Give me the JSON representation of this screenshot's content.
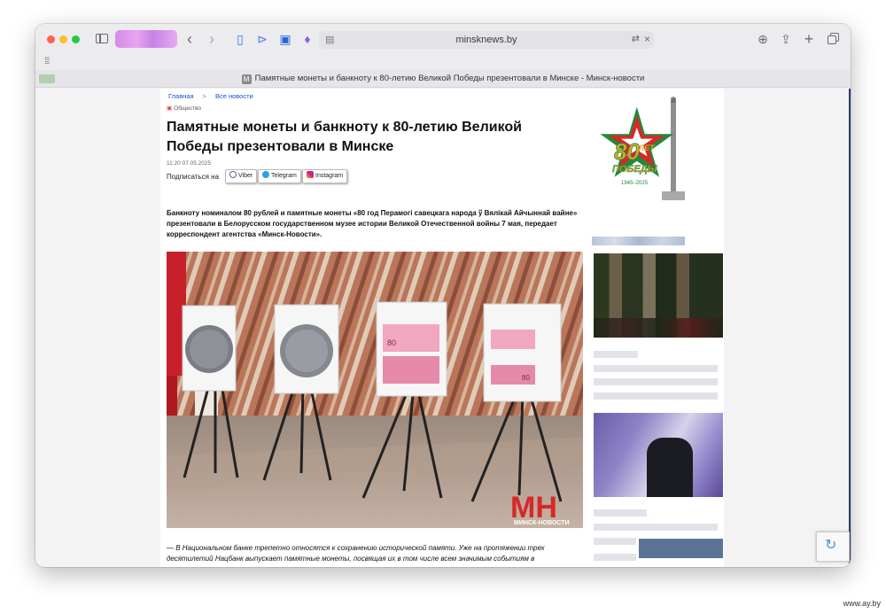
{
  "browser": {
    "url": "minsknews.by",
    "tab_title": "Памятные монеты и банкноту к 80-летию Великой Победы презентовали в Минске - Минск-новости",
    "tab_favicon_letter": "M"
  },
  "article": {
    "breadcrumb": [
      "Главная",
      ">",
      "Все новости"
    ],
    "category": "Общество",
    "title": "Памятные монеты и банкноту к 80-летию Великой Победы презентовали в Минске",
    "datetime": "11:20 07.05.2025",
    "subscribe_label": "Подписаться на",
    "social": [
      "Viber",
      "Telegram",
      "Instagram"
    ],
    "lead": "Банкноту номиналом 80 рублей и памятные монеты «80 год Перамогі савецкага народа ў Вялікай Айчыннай вайне» презентовали в Белорусском государственном музее истории Великой Отечественной войны 7 мая, передает корреспондент агентства «Минск-Новости».",
    "body": "— В Национальном банке трепетно относятся к сохранению исторической памяти. Уже на протяжении трех десятилетий Нацбанк выпускает памятные монеты, посвящая их в том числе всем значимым событиям в",
    "photo_watermark": "МИНСК-НОВОСТИ",
    "photo_logo": "МН",
    "banknote_denomination": "80"
  },
  "logo": {
    "big_text": "80",
    "line1": "ЛЕТ",
    "line2": "ПОБЕДЫ",
    "years": "1945–2025"
  },
  "page_watermark": "www.ay.by",
  "colors": {
    "accent_red": "#d62828",
    "link_blue": "#1a4fd1",
    "logo_green": "#1f8a3c",
    "logo_gold": "#e0a526"
  }
}
